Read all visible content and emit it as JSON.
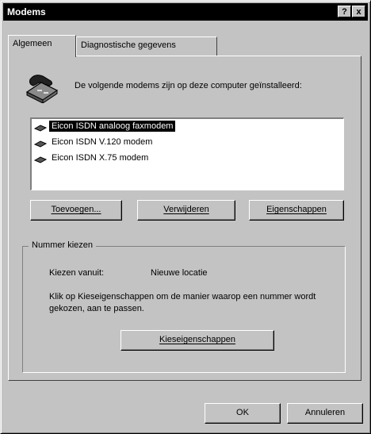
{
  "window": {
    "title": "Modems"
  },
  "titlebar_buttons": {
    "help": "?",
    "close": "x"
  },
  "tabs": [
    {
      "label": "Algemeen"
    },
    {
      "label": "Diagnostische gegevens"
    }
  ],
  "description": "De volgende modems zijn op deze computer geïnstalleerd:",
  "modems": [
    {
      "label": "Eicon ISDN analoog faxmodem"
    },
    {
      "label": "Eicon ISDN V.120 modem"
    },
    {
      "label": "Eicon ISDN X.75 modem"
    }
  ],
  "buttons": {
    "add": "Toevoegen...",
    "remove": "Verwijderen",
    "properties": "Eigenschappen",
    "dialing_properties": "Kieseigenschappen",
    "ok": "OK",
    "cancel": "Annuleren"
  },
  "dialing": {
    "group_label": "Nummer kiezen",
    "dial_from_label": "Kiezen vanuit:",
    "dial_from_value": "Nieuwe locatie",
    "info": "Klik op Kieseigenschappen om de manier waarop een nummer wordt gekozen, aan te passen."
  }
}
